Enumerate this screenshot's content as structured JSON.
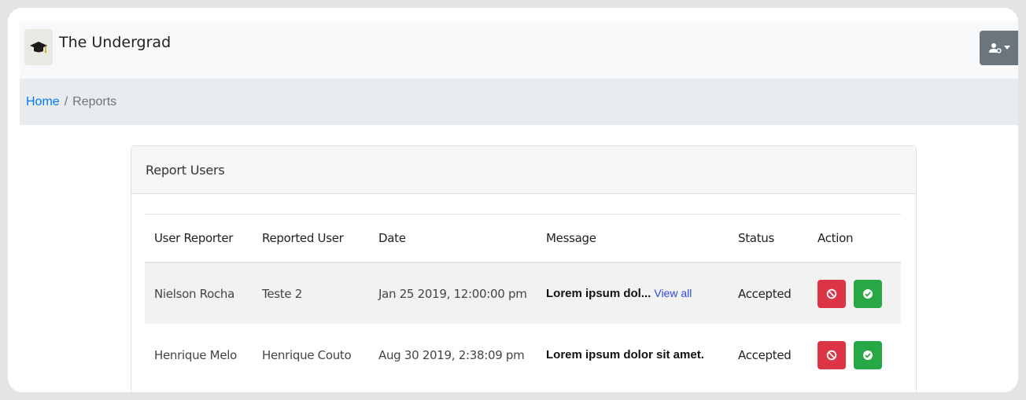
{
  "app": {
    "brand": "The Undergrad"
  },
  "breadcrumb": {
    "home": "Home",
    "separator": "/",
    "current": "Reports"
  },
  "card": {
    "title": "Report Users"
  },
  "table": {
    "headers": [
      "User Reporter",
      "Reported User",
      "Date",
      "Message",
      "Status",
      "Action"
    ],
    "rows": [
      {
        "reporter": "Nielson Rocha",
        "reported": "Teste 2",
        "date": "Jan 25 2019, 12:00:00 pm",
        "message": "Lorem ipsum dol...",
        "link": "View all",
        "status": "Accepted"
      },
      {
        "reporter": "Henrique Melo",
        "reported": "Henrique Couto",
        "date": "Aug 30 2019, 2:38:09 pm",
        "message": "Lorem ipsum dolor sit amet.",
        "status": "Accepted"
      }
    ]
  },
  "icons": {
    "brand": "graduation-cap-icon",
    "user_menu": "user-gear-icon",
    "reject": "ban-icon",
    "accept": "check-circle-icon"
  },
  "colors": {
    "danger": "#dc3545",
    "success": "#28a745",
    "link": "#007bff"
  }
}
